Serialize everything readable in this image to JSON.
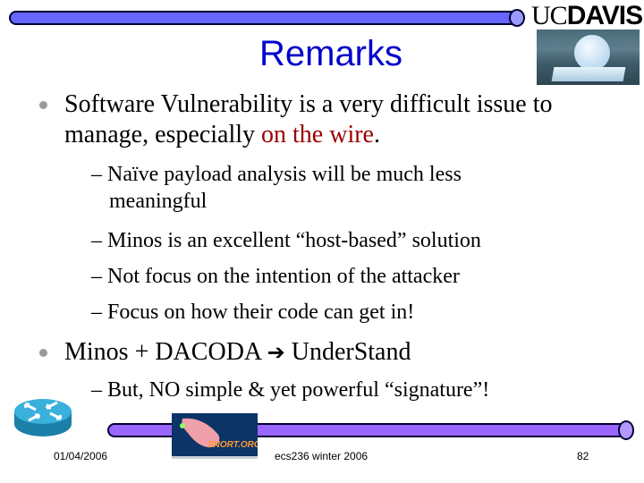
{
  "header": {
    "logo_text_uc": "UC",
    "logo_text_davis": "DAVIS",
    "photo_icon": "egghead-sculpture-photo"
  },
  "slide": {
    "title": "Remarks",
    "bullets": [
      {
        "text_before": "Software Vulnerability is a very difficult issue to manage, especially ",
        "text_highlight": "on the wire",
        "text_after": ".",
        "highlight_color": "#990000",
        "sub": [
          "– Naïve payload analysis will be much less meaningful",
          "– Minos is an excellent “host-based” solution",
          "– Not focus on the intention of the attacker",
          "– Focus on how their code can get in!"
        ]
      },
      {
        "text_before": "Minos + DACODA ",
        "arrow_icon": "right-arrow-icon",
        "arrow_glyph": "➔",
        "text_after": " UnderStand",
        "sub": [
          "– But, NO simple & yet powerful “signature”!"
        ]
      }
    ]
  },
  "footer": {
    "date": "01/04/2006",
    "course": "ecs236 winter 2006",
    "page_number": "82",
    "router_icon": "router-icon",
    "snort_logo_text": "SNORT.ORG"
  },
  "colors": {
    "title": "#0000cc",
    "top_bar": "#6666ff",
    "bottom_bar": "#9966ff"
  }
}
